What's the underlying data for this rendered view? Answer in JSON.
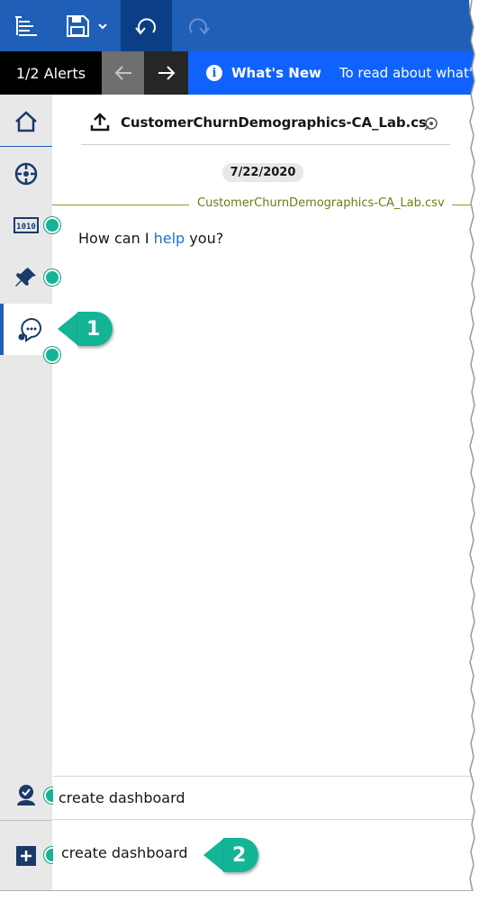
{
  "toolbar": {
    "menu_icon": "hamburger-tree-icon",
    "save_icon": "save-icon",
    "undo_icon": "undo-icon",
    "redo_icon": "redo-icon"
  },
  "alerts": {
    "count_label": "1/2 Alerts",
    "title": "What's New",
    "message": "To read about what's"
  },
  "rail": {
    "items": [
      "home-icon",
      "navigate-icon",
      "data-icon",
      "pin-icon",
      "assistant-chat-icon"
    ],
    "bottom": [
      "user-check-icon",
      "add-icon"
    ]
  },
  "chat": {
    "file_name": "CustomerChurnDemographics-CA_Lab.cs",
    "date": "7/22/2020",
    "source_label": "CustomerChurnDemographics-CA_Lab.csv",
    "greeting_pre": "How can I ",
    "greeting_link": "help",
    "greeting_post": " you?",
    "suggestion": "create dashboard",
    "input_value": "create dashboard"
  },
  "callouts": {
    "first": "1",
    "second": "2"
  },
  "colors": {
    "brand_blue": "#1f5fb8",
    "accent_green": "#13b596",
    "alert_blue": "#0f62fe"
  }
}
